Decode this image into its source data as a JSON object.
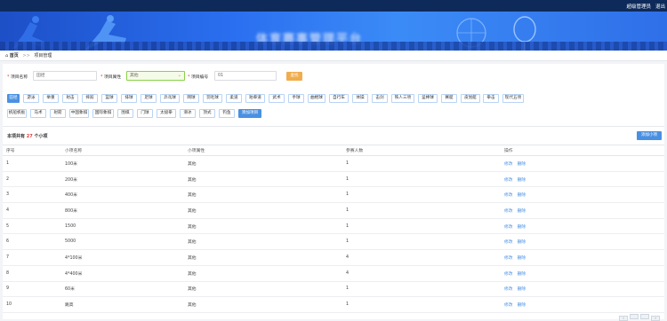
{
  "topbar": {
    "user": "超级管理员",
    "logout": "退出"
  },
  "banner": {
    "title": "体育赛事管理平台"
  },
  "breadcrumb": {
    "home": "首页",
    "separator": ">>",
    "current": "项目管理"
  },
  "filters": {
    "name_label": "项目名称",
    "name_value": "田径",
    "attr_label": "项目属性",
    "attr_value": "其他",
    "code_label": "项目编号",
    "code_value": "01",
    "search_button": "查找"
  },
  "categories": [
    "田径",
    "游泳",
    "举重",
    "射击",
    "摔跤",
    "篮球",
    "排球",
    "足球",
    "乒乓球",
    "网球",
    "羽毛球",
    "柔道",
    "跆拳道",
    "武术",
    "手球",
    "曲棍球",
    "自行车",
    "体操",
    "击剑",
    "铁人三项",
    "垒棒球",
    "赛艇",
    "皮划艇",
    "拳击",
    "现代五项",
    "帆船帆板",
    "马术",
    "射箭",
    "中国象棋",
    "国际象棋",
    "围棋",
    "门球",
    "太极拳",
    "滑冰",
    "顶式",
    "钓鱼"
  ],
  "active_category": "田径",
  "add_project_button": "添加项目",
  "summary": {
    "prefix": "本项共有",
    "count": "27",
    "suffix": "个小项"
  },
  "add_subitem_button": "添加小项",
  "table": {
    "headers": [
      "序号",
      "小项名称",
      "小项属性",
      "参赛人数",
      "操作"
    ],
    "rows": [
      [
        "1",
        "100米",
        "其他",
        "1"
      ],
      [
        "2",
        "200米",
        "其他",
        "1"
      ],
      [
        "3",
        "400米",
        "其他",
        "1"
      ],
      [
        "4",
        "800米",
        "其他",
        "1"
      ],
      [
        "5",
        "1500",
        "其他",
        "1"
      ],
      [
        "6",
        "5000",
        "其他",
        "1"
      ],
      [
        "7",
        "4*100米",
        "其他",
        "4"
      ],
      [
        "8",
        "4*400米",
        "其他",
        "4"
      ],
      [
        "9",
        "60米",
        "其他",
        "1"
      ],
      [
        "10",
        "跳高",
        "其他",
        "1"
      ]
    ],
    "edit_label": "修改",
    "delete_label": "删除"
  },
  "colors": {
    "accent": "#4a90e2",
    "topbar": "#0d2a5a",
    "warning": "#f0ad4e",
    "count": "#e53935"
  }
}
